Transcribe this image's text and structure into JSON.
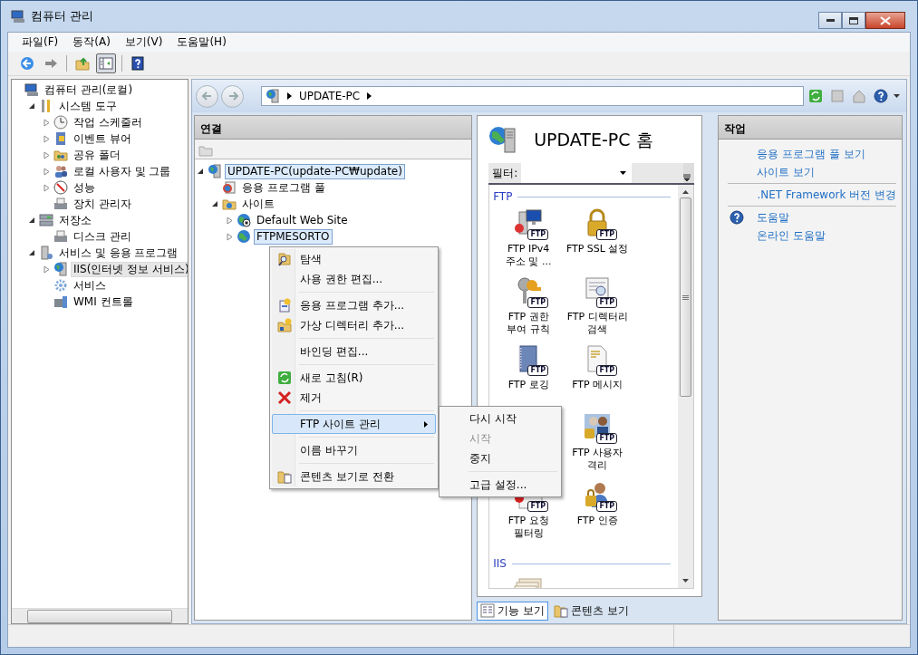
{
  "window": {
    "title": "컴퓨터 관리"
  },
  "menu_bar": [
    {
      "label": "파일(F)"
    },
    {
      "label": "동작(A)"
    },
    {
      "label": "보기(V)"
    },
    {
      "label": "도움말(H)"
    }
  ],
  "toolbar": [
    {
      "kind": "back",
      "pressed": false
    },
    {
      "kind": "forward",
      "pressed": false
    },
    {
      "kind": "separator"
    },
    {
      "kind": "up",
      "pressed": false
    },
    {
      "kind": "tree",
      "pressed": true
    },
    {
      "kind": "separator"
    },
    {
      "kind": "help",
      "pressed": false
    }
  ],
  "console_tree": [
    {
      "label": "컴퓨터 관리(로컬)",
      "selected": false,
      "children": [
        {
          "label": "시스템 도구",
          "expanded": true,
          "selected": false,
          "children": [
            {
              "label": "작업 스케줄러",
              "expanded": false,
              "selected": false
            },
            {
              "label": "이벤트 뷰어",
              "expanded": false,
              "selected": false
            },
            {
              "label": "공유 폴더",
              "expanded": false,
              "selected": false
            },
            {
              "label": "로컬 사용자 및 그룹",
              "expanded": false,
              "selected": false
            },
            {
              "label": "성능",
              "expanded": false,
              "selected": false
            },
            {
              "label": "장치 관리자",
              "selected": false
            }
          ]
        },
        {
          "label": "저장소",
          "expanded": true,
          "selected": false,
          "children": [
            {
              "label": "디스크 관리",
              "selected": false
            }
          ]
        },
        {
          "label": "서비스 및 응용 프로그램",
          "expanded": true,
          "selected": false,
          "children": [
            {
              "label": "IIS(인터넷 정보 서비스)",
              "expanded": false,
              "selected": true
            },
            {
              "label": "서비스",
              "selected": false
            },
            {
              "label": "WMI 컨트롤",
              "selected": false
            }
          ]
        }
      ]
    }
  ],
  "address_bar": {
    "crumbs": [
      "UPDATE-PC"
    ]
  },
  "connections": {
    "title": "연결",
    "tree": [
      {
        "label": "UPDATE-PC(update-PC₩update)",
        "expanded": true,
        "selected": true,
        "children": [
          {
            "label": "응용 프로그램 풀",
            "selected": false
          },
          {
            "label": "사이트",
            "expanded": true,
            "selected": false,
            "children": [
              {
                "label": "Default Web Site",
                "expanded": false,
                "selected": false
              },
              {
                "label": "FTPMESORTO",
                "expanded": false,
                "selected": true
              }
            ]
          }
        ]
      }
    ]
  },
  "home": {
    "title": "UPDATE-PC 홈",
    "filter_label": "필터:",
    "groups": [
      {
        "title": "FTP",
        "items": [
          {
            "kind": "feature",
            "label": "FTP IPv4 주소 및 ...",
            "badge": "FTP"
          },
          {
            "kind": "feature",
            "label": "FTP SSL 설정",
            "badge": "FTP"
          },
          {
            "kind": "feature",
            "label": "FTP 권한 부여 규칙",
            "badge": "FTP"
          },
          {
            "kind": "feature",
            "label": "FTP 디렉터리 검색",
            "badge": "FTP"
          },
          {
            "kind": "feature",
            "label": "FTP 로깅",
            "badge": "FTP"
          },
          {
            "kind": "feature",
            "label": "FTP 메시지",
            "badge": "FTP"
          },
          {
            "kind": "covered"
          },
          {
            "kind": "feature",
            "label": "FTP 사용자 격리",
            "badge": "FTP"
          },
          {
            "kind": "feature",
            "label": "FTP 요청 필터링",
            "badge": "FTP"
          },
          {
            "kind": "feature",
            "label": "FTP 인증",
            "badge": "FTP"
          }
        ]
      },
      {
        "title": "IIS",
        "items": [
          {
            "kind": "partial"
          }
        ]
      }
    ],
    "view_tabs": [
      {
        "label": "기능 보기",
        "selected": true
      },
      {
        "label": "콘텐츠 보기",
        "selected": false
      }
    ]
  },
  "actions": {
    "title": "작업",
    "groups": [
      [
        {
          "kind": "link",
          "label": "응용 프로그램 풀 보기"
        },
        {
          "kind": "link",
          "label": "사이트 보기"
        }
      ],
      [
        {
          "kind": "link",
          "label": ".NET Framework 버전 변경"
        }
      ],
      [
        {
          "kind": "help",
          "label": "도움말"
        },
        {
          "kind": "link",
          "label": "온라인 도움말"
        }
      ]
    ]
  },
  "context_menu": [
    {
      "kind": "item",
      "label": "탐색"
    },
    {
      "kind": "item",
      "label": "사용 권한 편집..."
    },
    {
      "kind": "separator"
    },
    {
      "kind": "item",
      "label": "응용 프로그램 추가..."
    },
    {
      "kind": "item",
      "label": "가상 디렉터리 추가..."
    },
    {
      "kind": "separator"
    },
    {
      "kind": "item",
      "label": "바인딩 편집..."
    },
    {
      "kind": "separator"
    },
    {
      "kind": "item",
      "label": "새로 고침(R)"
    },
    {
      "kind": "item",
      "label": "제거"
    },
    {
      "kind": "separator"
    },
    {
      "kind": "submenu",
      "label": "FTP 사이트 관리",
      "selected": true
    },
    {
      "kind": "separator"
    },
    {
      "kind": "item",
      "label": "이름 바꾸기"
    },
    {
      "kind": "separator"
    },
    {
      "kind": "item",
      "label": "콘텐츠 보기로 전환"
    }
  ],
  "submenu": [
    {
      "kind": "item",
      "label": "다시 시작",
      "disabled": false
    },
    {
      "kind": "item",
      "label": "시작",
      "disabled": true
    },
    {
      "kind": "item",
      "label": "중지",
      "disabled": false
    },
    {
      "kind": "separator"
    },
    {
      "kind": "item",
      "label": "고급 설정...",
      "disabled": false
    }
  ]
}
